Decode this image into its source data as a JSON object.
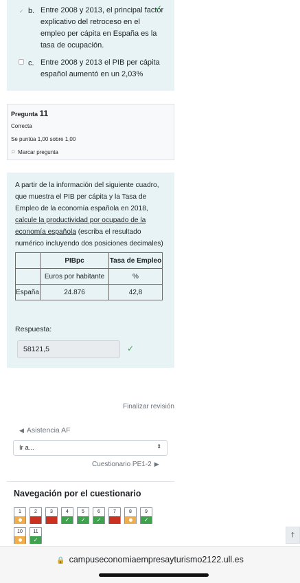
{
  "prev_answers": {
    "b": {
      "letter": "b.",
      "text_lines": [
        "Entre 2008 y 2013, el principal factor",
        "explicativo del retroceso en el",
        "empleo per cápita en España es la",
        "tasa de ocupación."
      ]
    },
    "c": {
      "letter": "c.",
      "text_lines": [
        "Entre 2008 y 2013 el PIB per cápita",
        "español aumentó en un 2,03%"
      ]
    }
  },
  "question_info": {
    "label": "Pregunta",
    "number": "11",
    "status": "Correcta",
    "grade": "Se puntúa 1,00 sobre 1,00",
    "flag_label": "Marcar pregunta"
  },
  "question": {
    "lines": [
      "A partir de la  información del siguiente cuadro,",
      "que muestra el PIB per cápita y la Tasa de",
      "Empleo de la economía española en 2018,"
    ],
    "underlined_1": "calcule la productividad por ocupado de la",
    "underlined_2": "economía española",
    "after_underline": " (escriba el resultado",
    "last_line": "numérico incluyendo dos posiciones decimales)",
    "table": {
      "headers": [
        "",
        "PIBpc",
        "Tasa de Empleo"
      ],
      "units": [
        "",
        "Euros por habitante",
        "%"
      ],
      "row": [
        "España",
        "24.876",
        "42,8"
      ]
    },
    "response_label": "Respuesta:",
    "response_value": "58121,5"
  },
  "finish_review": "Finalizar revisión",
  "prev_activity": "Asistencia AF",
  "jump_select": "Ir a...",
  "next_activity": "Cuestionario PE1-2",
  "nav": {
    "title": "Navegación por el cuestionario",
    "buttons": [
      {
        "n": "1",
        "state": "partial"
      },
      {
        "n": "2",
        "state": "incorrect"
      },
      {
        "n": "3",
        "state": "incorrect"
      },
      {
        "n": "4",
        "state": "correct"
      },
      {
        "n": "5",
        "state": "correct"
      },
      {
        "n": "6",
        "state": "correct"
      },
      {
        "n": "7",
        "state": "incorrect"
      },
      {
        "n": "8",
        "state": "partial"
      },
      {
        "n": "9",
        "state": "correct"
      },
      {
        "n": "10",
        "state": "partial"
      },
      {
        "n": "11",
        "state": "correct"
      }
    ]
  },
  "browser": {
    "url": "campuseconomiaempresayturismo2122.ull.es"
  },
  "colors": {
    "correct": "#3fa34d",
    "incorrect": "#ca3120",
    "partial": "#f0ad4e",
    "panel": "#e7f3f5"
  }
}
